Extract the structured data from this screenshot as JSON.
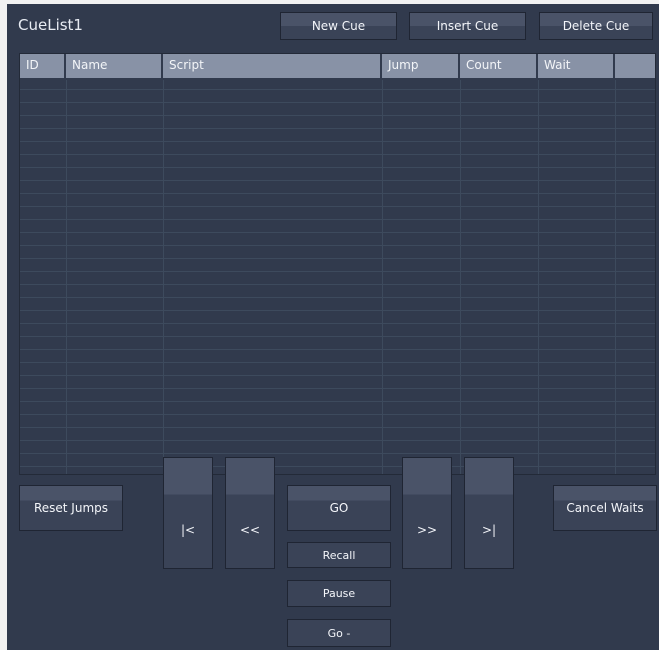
{
  "window": {
    "title": "CueList1"
  },
  "toolbar": {
    "new_cue": "New Cue",
    "insert_cue": "Insert Cue",
    "delete_cue": "Delete Cue"
  },
  "table": {
    "columns": [
      "ID",
      "Name",
      "Script",
      "Jump",
      "Count",
      "Wait",
      ""
    ],
    "rows": []
  },
  "controls": {
    "reset_jumps": "Reset Jumps",
    "first": "|<",
    "prev": "<<",
    "go": "GO",
    "recall": "Recall",
    "pause": "Pause",
    "go_back": "Go -",
    "next": ">>",
    "last": ">|",
    "cancel_waits": "Cancel Waits"
  },
  "colors": {
    "panel": "#313a4d",
    "header": "#8892a6",
    "button": "#3a4357",
    "gridline": "#3d4a5d"
  }
}
